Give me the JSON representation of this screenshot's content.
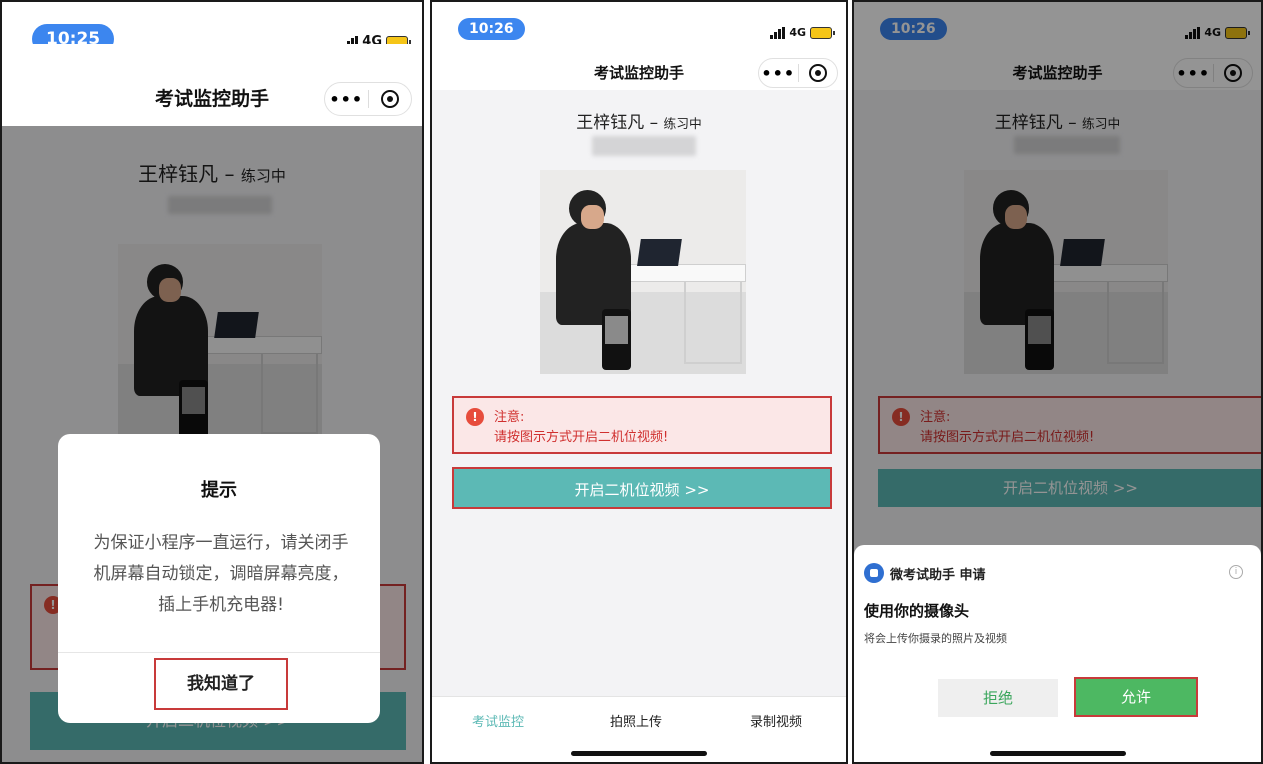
{
  "status": {
    "p1_time": "10:25",
    "p2_time": "10:26",
    "p3_time": "10:26",
    "network": "4G",
    "accent_color": "#3c86ef"
  },
  "app": {
    "title": "考试监控助手",
    "capsule_more": "•••"
  },
  "student": {
    "name": "王梓钰凡",
    "dash": "–",
    "status": "练习中"
  },
  "notice": {
    "label": "注意:",
    "text": "请按图示方式开启二机位视频!",
    "warn_icon": "!",
    "color": "#d0302f"
  },
  "main": {
    "start_second_camera": "开启二机位视频 >>"
  },
  "tabs": [
    {
      "label": "考试监控",
      "active": true
    },
    {
      "label": "拍照上传",
      "active": false
    },
    {
      "label": "录制视频",
      "active": false
    }
  ],
  "dialog": {
    "title": "提示",
    "body": "为保证小程序一直运行，请关闭手机屏幕自动锁定，调暗屏幕亮度，插上手机充电器!",
    "confirm": "我知道了"
  },
  "permission": {
    "app_name": "微考试助手 申请",
    "info_icon": "i",
    "request": "使用你的摄像头",
    "description": "将会上传你摄录的照片及视频",
    "deny": "拒绝",
    "allow": "允许"
  },
  "icons": [
    "signal-icon",
    "battery-icon",
    "more-icon",
    "target-icon",
    "warning-icon",
    "info-icon",
    "app-icon"
  ]
}
